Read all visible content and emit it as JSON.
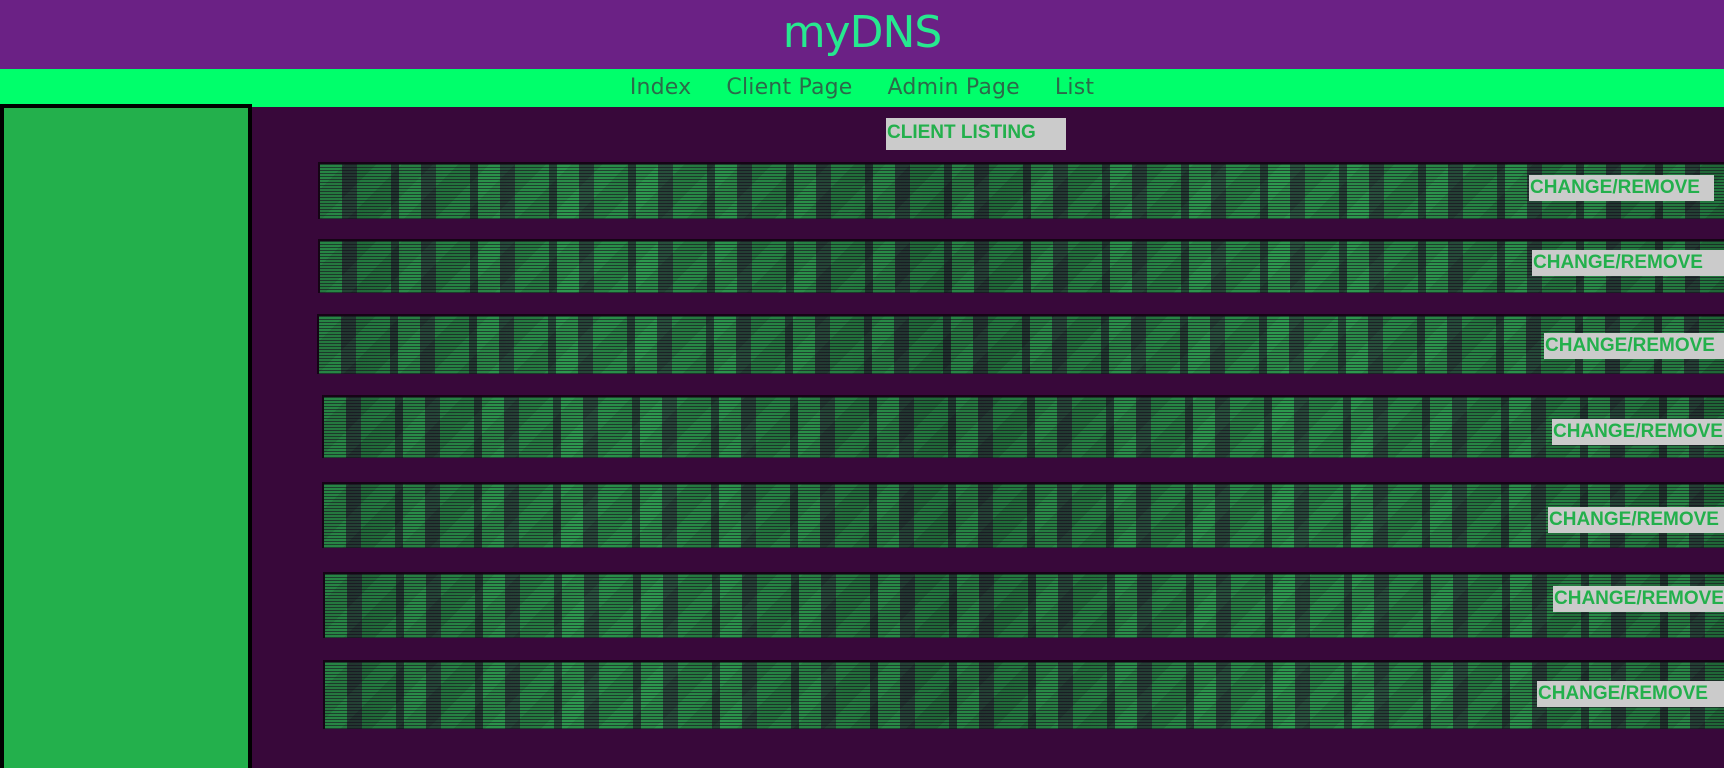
{
  "header": {
    "title": "myDNS"
  },
  "nav": {
    "items": [
      {
        "label": "Index"
      },
      {
        "label": "Client Page"
      },
      {
        "label": "Admin Page"
      },
      {
        "label": "List"
      }
    ]
  },
  "main": {
    "listing_title": "CLIENT LISTING",
    "rows": [
      {
        "action_label": "CHANGE/REMOVE"
      },
      {
        "action_label": "CHANGE/REMOVE"
      },
      {
        "action_label": "CHANGE/REMOVE"
      },
      {
        "action_label": "CHANGE/REMOVE"
      },
      {
        "action_label": "CHANGE/REMOVE"
      },
      {
        "action_label": "CHANGE/REMOVE"
      },
      {
        "action_label": "CHANGE/REMOVE"
      }
    ]
  },
  "colors": {
    "header_bg": "#6b2185",
    "title_color": "#27e88f",
    "nav_bg": "#00ff6b",
    "nav_text": "#2c6a49",
    "page_bg": "#38083a",
    "sidebar_bg": "#23b04c",
    "button_bg": "#cbcbcb",
    "button_text": "#23b04c"
  }
}
